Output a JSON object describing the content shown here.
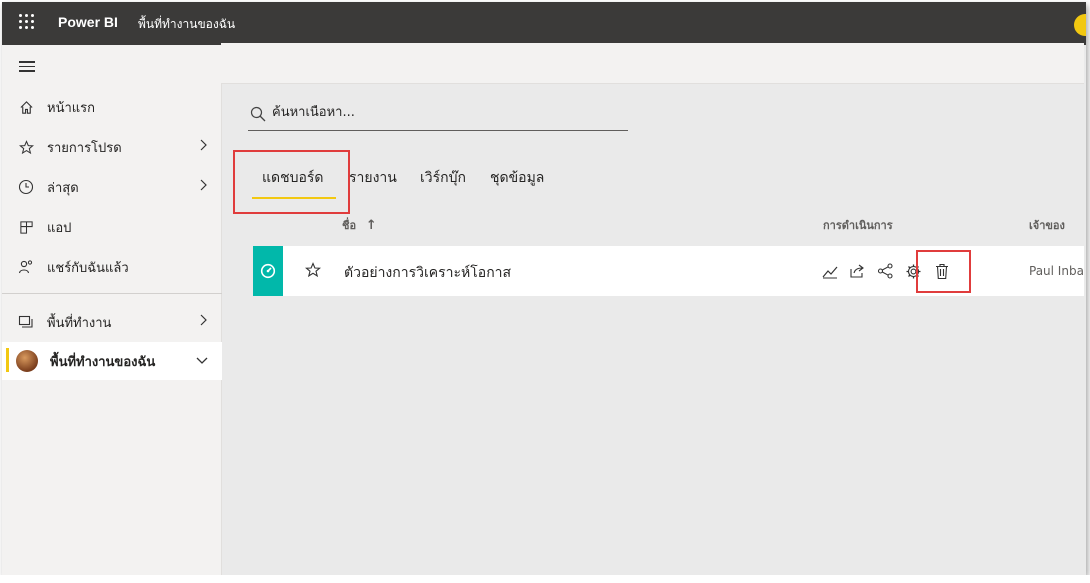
{
  "topbar": {
    "app_name": "Power BI",
    "breadcrumb": "พื้นที่ทำงานของฉัน"
  },
  "sidebar": {
    "items": [
      {
        "label": "หน้าแรก",
        "icon": "home-icon"
      },
      {
        "label": "รายการโปรด",
        "icon": "star-icon",
        "expandable": true
      },
      {
        "label": "ล่าสุด",
        "icon": "clock-icon",
        "expandable": true
      },
      {
        "label": "แอป",
        "icon": "apps-icon"
      },
      {
        "label": "แชร์กับฉันแล้ว",
        "icon": "shared-person-icon"
      },
      {
        "label": "พื้นที่ทำงาน",
        "icon": "workspaces-icon",
        "expandable": true
      },
      {
        "label": "พื้นที่ทำงานของฉัน",
        "icon": "avatar",
        "expanded": true,
        "active": true
      }
    ]
  },
  "search": {
    "placeholder": "ค้นหาเนื้อหา..."
  },
  "tabs": [
    {
      "label": "แดชบอร์ด",
      "selected": true
    },
    {
      "label": "รายงาน"
    },
    {
      "label": "เวิร์กบุ๊ก"
    },
    {
      "label": "ชุดข้อมูล"
    }
  ],
  "table": {
    "columns": {
      "name": "ชื่อ",
      "name_sort": "↑",
      "actions": "การดำเนินการ",
      "owner": "เจ้าของ"
    },
    "rows": [
      {
        "name": "ตัวอย่างการวิเคราะห์โอกาส",
        "owner": "Paul Inba",
        "actions": [
          "insights-icon",
          "share-icon",
          "related-content-icon",
          "settings-icon",
          "delete-icon"
        ]
      }
    ]
  },
  "colors": {
    "topbar": "#3b3a39",
    "accent_yellow": "#f2c811",
    "dashboard_tile": "#01b8aa",
    "highlight_red": "#e03c3c"
  }
}
